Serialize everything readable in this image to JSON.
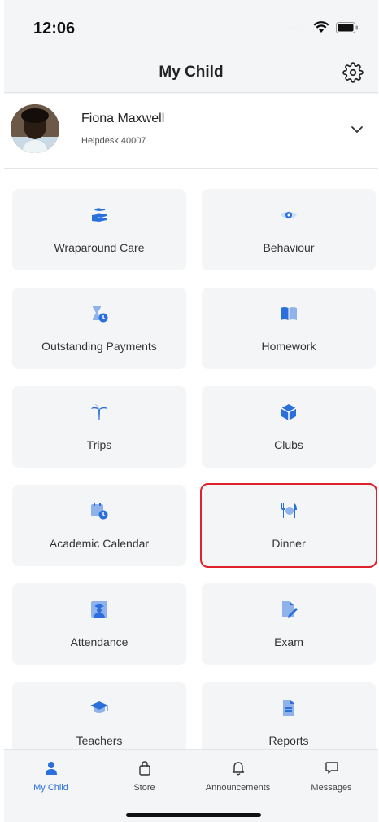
{
  "status_bar": {
    "time": "12:06",
    "signal": "....."
  },
  "nav": {
    "title": "My Child"
  },
  "child": {
    "name": "Fiona Maxwell",
    "subtitle": "Helpdesk 40007"
  },
  "tiles": [
    {
      "label": "Wraparound Care",
      "icon": "hand-heart-icon"
    },
    {
      "label": "Behaviour",
      "icon": "eye-icon"
    },
    {
      "label": "Outstanding Payments",
      "icon": "hourglass-clock-icon"
    },
    {
      "label": "Homework",
      "icon": "book-icon"
    },
    {
      "label": "Trips",
      "icon": "palm-tree-icon"
    },
    {
      "label": "Clubs",
      "icon": "box-icon"
    },
    {
      "label": "Academic Calendar",
      "icon": "calendar-clock-icon"
    },
    {
      "label": "Dinner",
      "icon": "cutlery-icon",
      "highlighted": true
    },
    {
      "label": "Attendance",
      "icon": "student-board-icon"
    },
    {
      "label": "Exam",
      "icon": "file-pen-icon"
    },
    {
      "label": "Teachers",
      "icon": "graduation-cap-icon"
    },
    {
      "label": "Reports",
      "icon": "report-file-icon"
    }
  ],
  "tabs": [
    {
      "label": "My Child",
      "icon": "person-icon",
      "active": true
    },
    {
      "label": "Store",
      "icon": "shopping-bag-icon"
    },
    {
      "label": "Announcements",
      "icon": "bell-icon"
    },
    {
      "label": "Messages",
      "icon": "chat-bubble-icon"
    }
  ],
  "colors": {
    "accent": "#2a6fdb",
    "highlight": "#e0202a",
    "tile_bg": "#f4f5f7"
  }
}
